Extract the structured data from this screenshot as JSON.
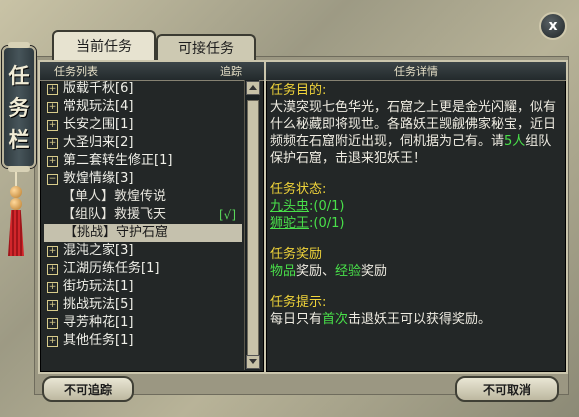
{
  "window": {
    "side_title": [
      "任",
      "务",
      "栏"
    ]
  },
  "tabs": [
    {
      "label": "当前任务",
      "active": true
    },
    {
      "label": "可接任务",
      "active": false
    }
  ],
  "list_panel": {
    "header": "任务列表",
    "track_header": "追踪",
    "items": [
      {
        "label": "版载千秋[6]",
        "expanded": false
      },
      {
        "label": "常规玩法[4]",
        "expanded": false
      },
      {
        "label": "长安之围[1]",
        "expanded": false
      },
      {
        "label": "大圣归来[2]",
        "expanded": false
      },
      {
        "label": "第二套转生修正[1]",
        "expanded": false
      },
      {
        "label": "敦煌情缘[3]",
        "expanded": true
      },
      {
        "label": "【单人】敦煌传说",
        "sub": true
      },
      {
        "label": "【组队】救援飞天",
        "sub": true,
        "tracked": "[√]"
      },
      {
        "label": "【挑战】守护石窟",
        "sub": true,
        "selected": true
      },
      {
        "label": "混沌之家[3]",
        "expanded": false
      },
      {
        "label": "江湖历练任务[1]",
        "expanded": false
      },
      {
        "label": "街坊玩法[1]",
        "expanded": false
      },
      {
        "label": "挑战玩法[5]",
        "expanded": false
      },
      {
        "label": "寻芳种花[1]",
        "expanded": false
      },
      {
        "label": "其他任务[1]",
        "expanded": false
      }
    ]
  },
  "detail_panel": {
    "header": "任务详情",
    "goal_title": "任务目的:",
    "goal_text_1": "大漠突现七色华光，石窟之上更是金光闪耀，似有什么秘藏即将现世。各路妖王觊觎佛家秘宝，近日频频在石窟附近出现，伺机据为己有。请",
    "goal_highlight": "5人",
    "goal_text_2": "组队保护石窟，击退来犯妖王！",
    "status_title": "任务状态:",
    "status_1_link": "九头虫",
    "status_1_count": ":(0/1)",
    "status_2_link": "狮驼王",
    "status_2_count": ":(0/1)",
    "reward_title": "任务奖励",
    "reward_item": "物品",
    "reward_mid": "奖励、",
    "reward_exp": "经验",
    "reward_end": "奖励",
    "hint_title": "任务提示:",
    "hint_text_1": "每日只有",
    "hint_highlight": "首次",
    "hint_text_2": "击退妖王可以获得奖励。"
  },
  "buttons": {
    "untrack": "不可追踪",
    "cancel": "不可取消",
    "close": "x"
  }
}
